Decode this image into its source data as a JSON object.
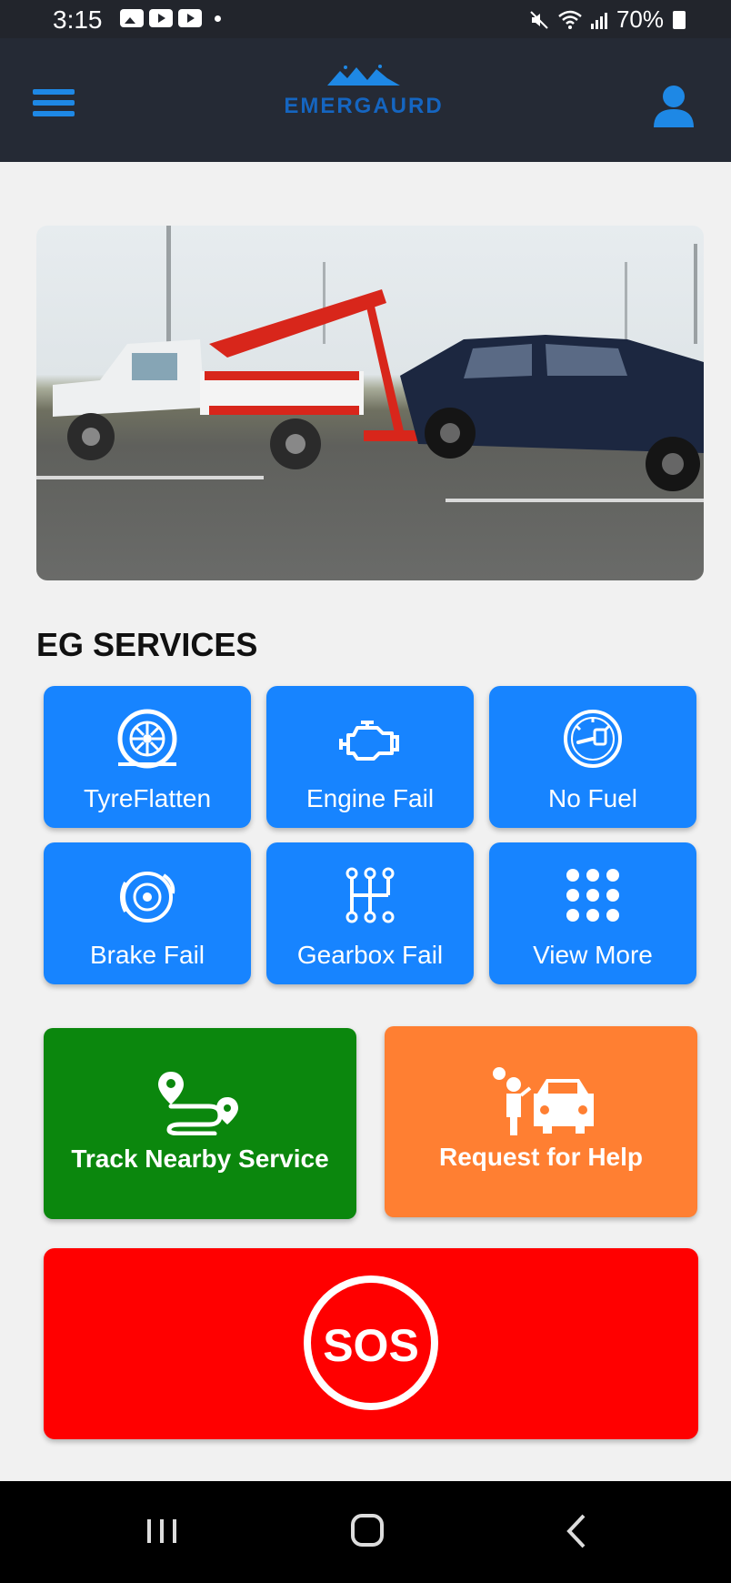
{
  "status_bar": {
    "time": "3:15",
    "battery": "70%",
    "icons": [
      "gallery-icon",
      "youtube-icon",
      "youtube-icon",
      "mute-icon",
      "wifi-icon",
      "signal-icon",
      "battery-icon"
    ]
  },
  "app_bar": {
    "logo_name": "EMERGAURD",
    "menu_icon": "hamburger-menu-icon",
    "profile_icon": "user-profile-icon"
  },
  "colors": {
    "app_bar": "#252a35",
    "accent_blue": "#1784ff",
    "track_green": "#0b870d",
    "help_orange": "#ff7f32",
    "sos_red": "#ff0000"
  },
  "section_title": "EG SERVICES",
  "services": [
    {
      "label": "TyreFlatten",
      "icon": "tyre-icon"
    },
    {
      "label": "Engine Fail",
      "icon": "engine-icon"
    },
    {
      "label": "No Fuel",
      "icon": "fuel-gauge-icon"
    },
    {
      "label": "Brake Fail",
      "icon": "brake-icon"
    },
    {
      "label": "Gearbox Fail",
      "icon": "gearbox-icon"
    },
    {
      "label": "View More",
      "icon": "grid-dots-icon"
    }
  ],
  "actions": {
    "track_label": "Track Nearby Service",
    "help_label": "Request for Help"
  },
  "sos_label": "SOS",
  "nav": [
    "recents-icon",
    "home-icon",
    "back-icon"
  ]
}
